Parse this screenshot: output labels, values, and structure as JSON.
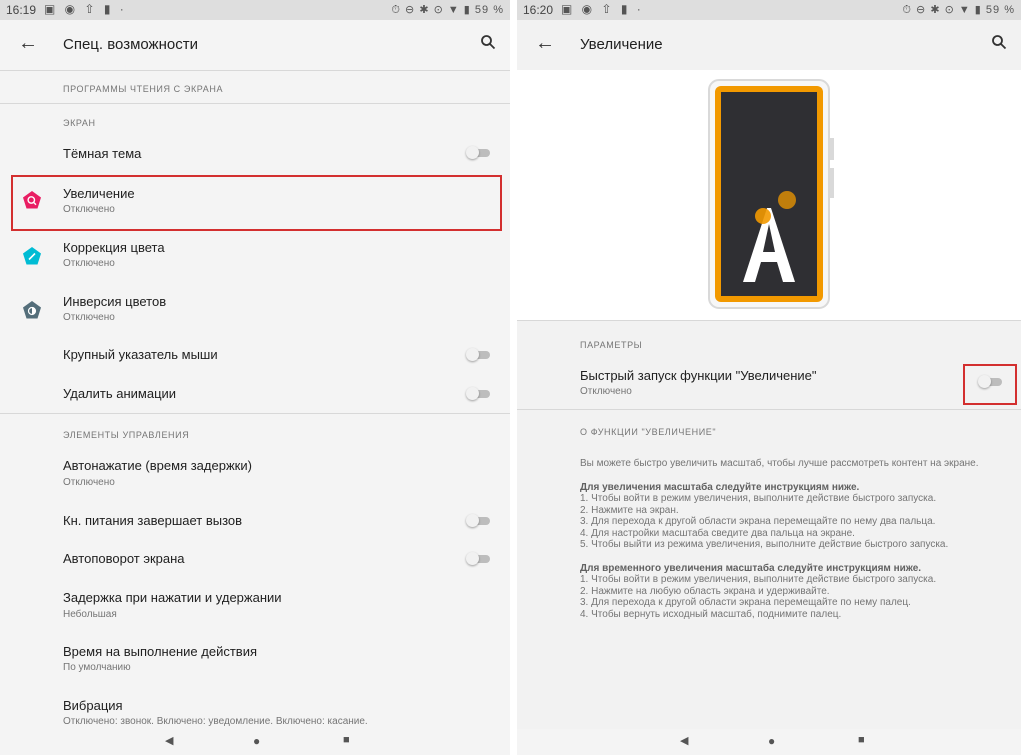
{
  "left": {
    "status": {
      "time": "16:19",
      "right_icons": "⏱ ⊖ ✱ ⊙ ▼ ▮ 59 %"
    },
    "appbar": {
      "title": "Спец. возможности"
    },
    "sections": {
      "screen_readers": "Программы чтения с экрана",
      "display": "Экран",
      "controls": "Элементы управления"
    },
    "items": {
      "dark_theme": {
        "title": "Тёмная тема"
      },
      "magnification": {
        "title": "Увеличение",
        "summary": "Отключено"
      },
      "color_correction": {
        "title": "Коррекция цвета",
        "summary": "Отключено"
      },
      "color_inversion": {
        "title": "Инверсия цветов",
        "summary": "Отключено"
      },
      "large_pointer": {
        "title": "Крупный указатель мыши"
      },
      "remove_animations": {
        "title": "Удалить анимации"
      },
      "autoclick": {
        "title": "Автонажатие (время задержки)",
        "summary": "Отключено"
      },
      "power_ends_call": {
        "title": "Кн. питания завершает вызов"
      },
      "auto_rotate": {
        "title": "Автоповорот экрана"
      },
      "touch_hold_delay": {
        "title": "Задержка при нажатии и удержании",
        "summary": "Небольшая"
      },
      "time_to_act": {
        "title": "Время на выполнение действия",
        "summary": "По умолчанию"
      },
      "vibration": {
        "title": "Вибрация",
        "summary": "Отключено: звонок. Включено: уведомление. Включено: касание."
      }
    },
    "icon_colors": {
      "magnification": "#e91e63",
      "color_correction": "#00bcd4",
      "color_inversion": "#546e7a"
    }
  },
  "right": {
    "status": {
      "time": "16:20",
      "right_icons": "⏱ ⊖ ✱ ⊙ ▼ ▮ 59 %"
    },
    "appbar": {
      "title": "Увеличение"
    },
    "sections": {
      "params": "Параметры",
      "about": "О функции \"Увеличение\""
    },
    "shortcut": {
      "title": "Быстрый запуск функции \"Увеличение\"",
      "summary": "Отключено"
    },
    "about": {
      "intro": "Вы можете быстро увеличить масштаб, чтобы лучше рассмотреть контент на экране.",
      "block1_heading": "Для увеличения масштаба следуйте инструкциям ниже.",
      "block1_steps": [
        "1. Чтобы войти в режим увеличения, выполните действие быстрого запуска.",
        "2. Нажмите на экран.",
        "3. Для перехода к другой области экрана перемещайте по нему два пальца.",
        "4. Для настройки масштаба сведите два пальца на экране.",
        "5. Чтобы выйти из режима увеличения, выполните действие быстрого запуска."
      ],
      "block2_heading": "Для временного увеличения масштаба следуйте инструкциям ниже.",
      "block2_steps": [
        "1. Чтобы войти в режим увеличения, выполните действие быстрого запуска.",
        "2. Нажмите на любую область экрана и удерживайте.",
        "3. Для перехода к другой области экрана перемещайте по нему палец.",
        "4. Чтобы вернуть исходный масштаб, поднимите палец."
      ]
    },
    "illustration": {
      "letter": "A",
      "frame_color": "#f29900",
      "screen_color": "#2f2f33"
    }
  },
  "highlight_color": "#d32f2f"
}
